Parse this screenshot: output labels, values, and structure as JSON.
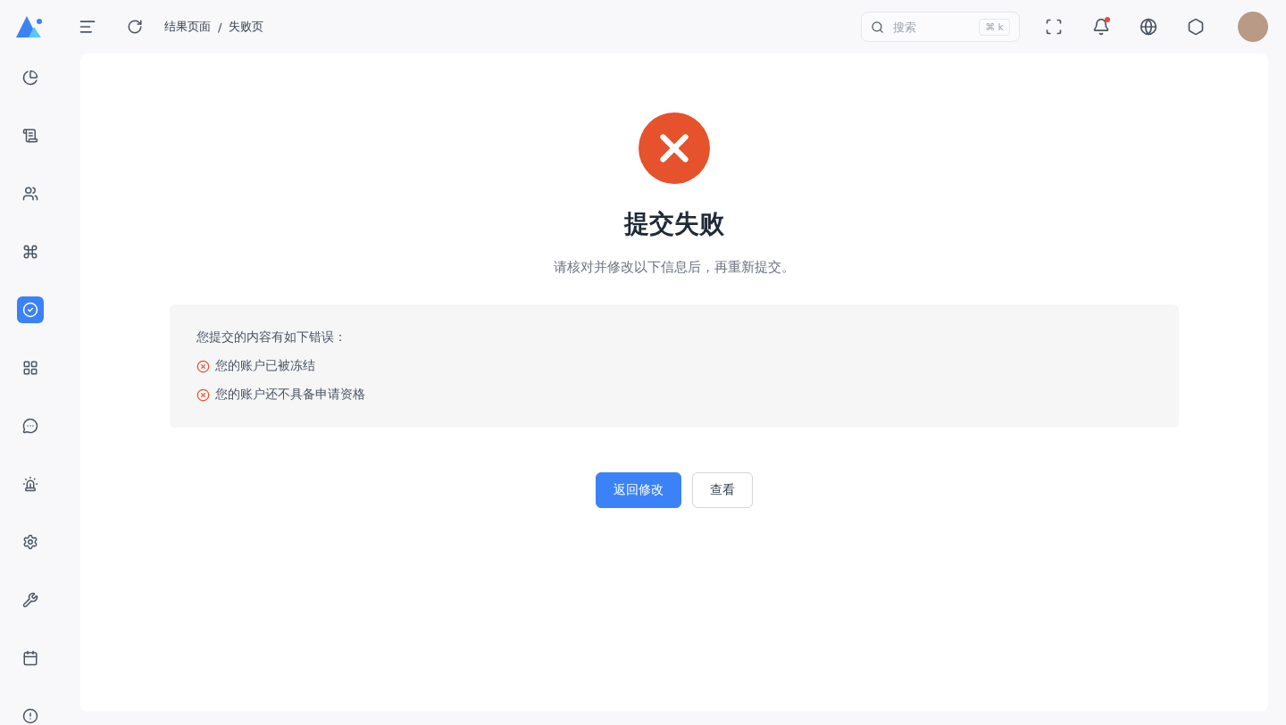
{
  "header": {
    "breadcrumb": [
      "结果页面",
      "失败页"
    ],
    "breadcrumb_separator": "/",
    "search": {
      "placeholder": "搜索",
      "shortcut": "⌘ k"
    },
    "notifications": {
      "unread": true
    }
  },
  "sidebar": {
    "items": [
      {
        "selected": false
      },
      {
        "selected": false
      },
      {
        "selected": false
      },
      {
        "selected": false
      },
      {
        "selected": true
      },
      {
        "selected": false
      },
      {
        "selected": false
      },
      {
        "selected": false
      },
      {
        "selected": false
      },
      {
        "selected": false
      },
      {
        "selected": false
      },
      {
        "selected": false
      }
    ]
  },
  "result": {
    "title": "提交失败",
    "subtitle": "请核对并修改以下信息后，再重新提交。",
    "errors": {
      "heading": "您提交的内容有如下错误：",
      "items": [
        "您的账户已被冻结",
        "您的账户还不具备申请资格"
      ]
    },
    "buttons": [
      {
        "label": "返回修改",
        "kind": "primary"
      },
      {
        "label": "查看",
        "kind": "default"
      }
    ]
  }
}
